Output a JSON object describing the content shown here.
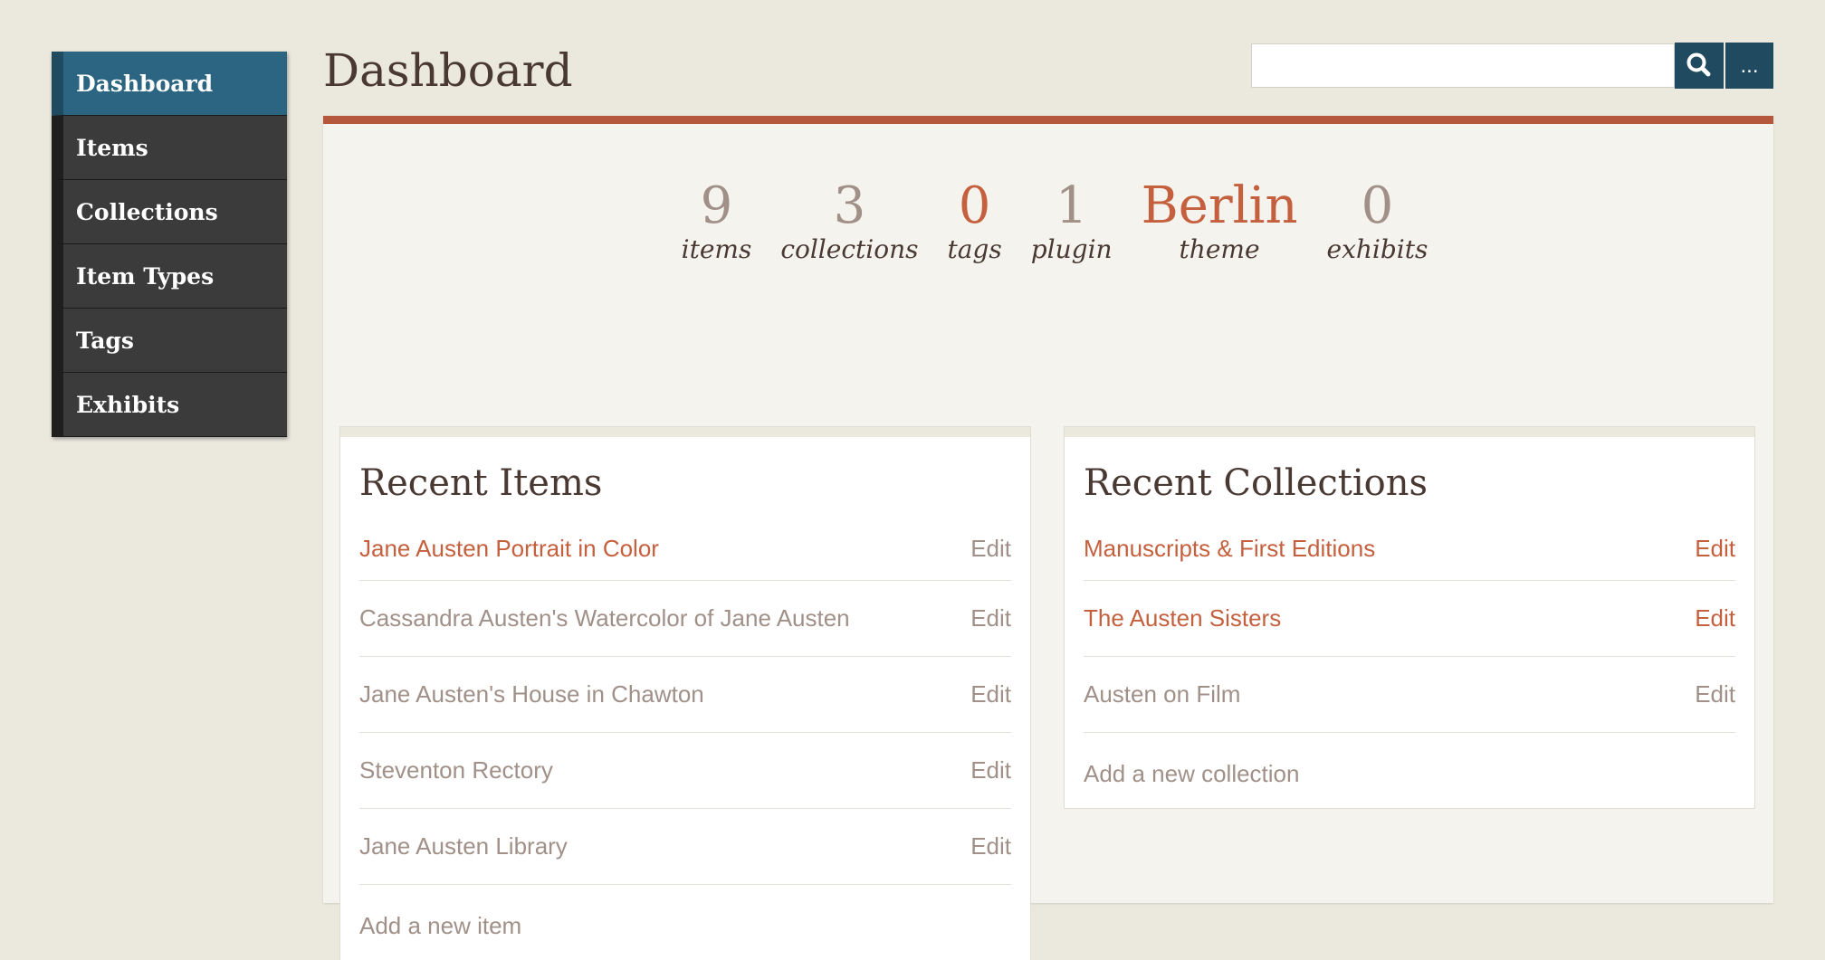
{
  "nav": {
    "items": [
      {
        "label": "Dashboard",
        "active": true
      },
      {
        "label": "Items"
      },
      {
        "label": "Collections"
      },
      {
        "label": "Item Types"
      },
      {
        "label": "Tags"
      },
      {
        "label": "Exhibits"
      }
    ]
  },
  "header": {
    "title": "Dashboard",
    "search_value": "",
    "more_label": "..."
  },
  "stats": [
    {
      "value": "9",
      "label": "items"
    },
    {
      "value": "3",
      "label": "collections"
    },
    {
      "value": "0",
      "label": "tags",
      "accent": true
    },
    {
      "value": "1",
      "label": "plugin"
    },
    {
      "value": "Berlin",
      "label": "theme",
      "accent": true
    },
    {
      "value": "0",
      "label": "exhibits"
    }
  ],
  "recent_items": {
    "title": "Recent Items",
    "rows": [
      {
        "label": "Jane Austen Portrait in Color",
        "edit": "Edit",
        "highlight": true
      },
      {
        "label": "Cassandra Austen's Watercolor of Jane Austen",
        "edit": "Edit"
      },
      {
        "label": "Jane Austen's House in Chawton",
        "edit": "Edit"
      },
      {
        "label": "Steventon Rectory",
        "edit": "Edit"
      },
      {
        "label": "Jane Austen Library",
        "edit": "Edit"
      }
    ],
    "add_label": "Add a new item"
  },
  "recent_collections": {
    "title": "Recent Collections",
    "rows": [
      {
        "label": "Manuscripts & First Editions",
        "edit": "Edit",
        "highlight": true
      },
      {
        "label": "The Austen Sisters",
        "edit": "Edit",
        "highlight": true
      },
      {
        "label": "Austen on Film",
        "edit": "Edit"
      }
    ],
    "add_label": "Add a new collection"
  },
  "colors": {
    "accent": "#c5603e",
    "nav_active": "#2c6581",
    "panel_border": "#b5573c",
    "muted_text": "#a09088",
    "heading": "#4a3933"
  },
  "icons": {
    "search": "search-icon"
  }
}
